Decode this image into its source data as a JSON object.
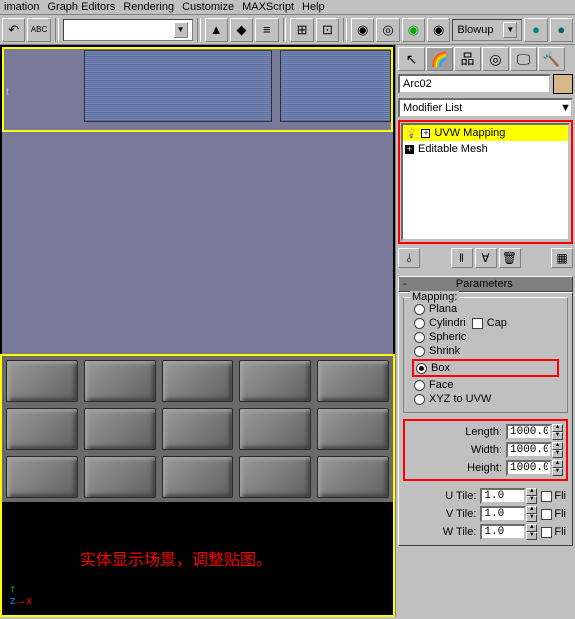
{
  "menu": {
    "items": [
      "imation",
      "Graph Editors",
      "Rendering",
      "Customize",
      "MAXScript",
      "Help"
    ]
  },
  "toolbar": {
    "render_preset": "Blowup"
  },
  "panel": {
    "object_name": "Arc02",
    "modifier_list_label": "Modifier List",
    "stack": [
      {
        "label": "UVW Mapping",
        "selected": true
      },
      {
        "label": "Editable Mesh",
        "selected": false
      }
    ],
    "rollout_title": "Parameters",
    "mapping": {
      "label": "Mapping:",
      "opts": [
        "Plana",
        "Cylindri",
        "Spheric",
        "Shrink",
        "Box",
        "Face",
        "XYZ to UVW"
      ],
      "selected": 4,
      "cap_label": "Cap"
    },
    "dims": {
      "length": {
        "label": "Length:",
        "value": "1000.0"
      },
      "width": {
        "label": "Width:",
        "value": "1000.0"
      },
      "height": {
        "label": "Height:",
        "value": "1000.0"
      }
    },
    "tiles": {
      "u": {
        "label": "U Tile:",
        "value": "1.0",
        "flip": "Fli"
      },
      "v": {
        "label": "V Tile:",
        "value": "1.0",
        "flip": "Fli"
      },
      "w": {
        "label": "W Tile:",
        "value": "1.0",
        "flip": "Fli"
      }
    }
  },
  "viewport": {
    "top_label": "t",
    "annotation": "实体显示场景，调整贴图。"
  }
}
